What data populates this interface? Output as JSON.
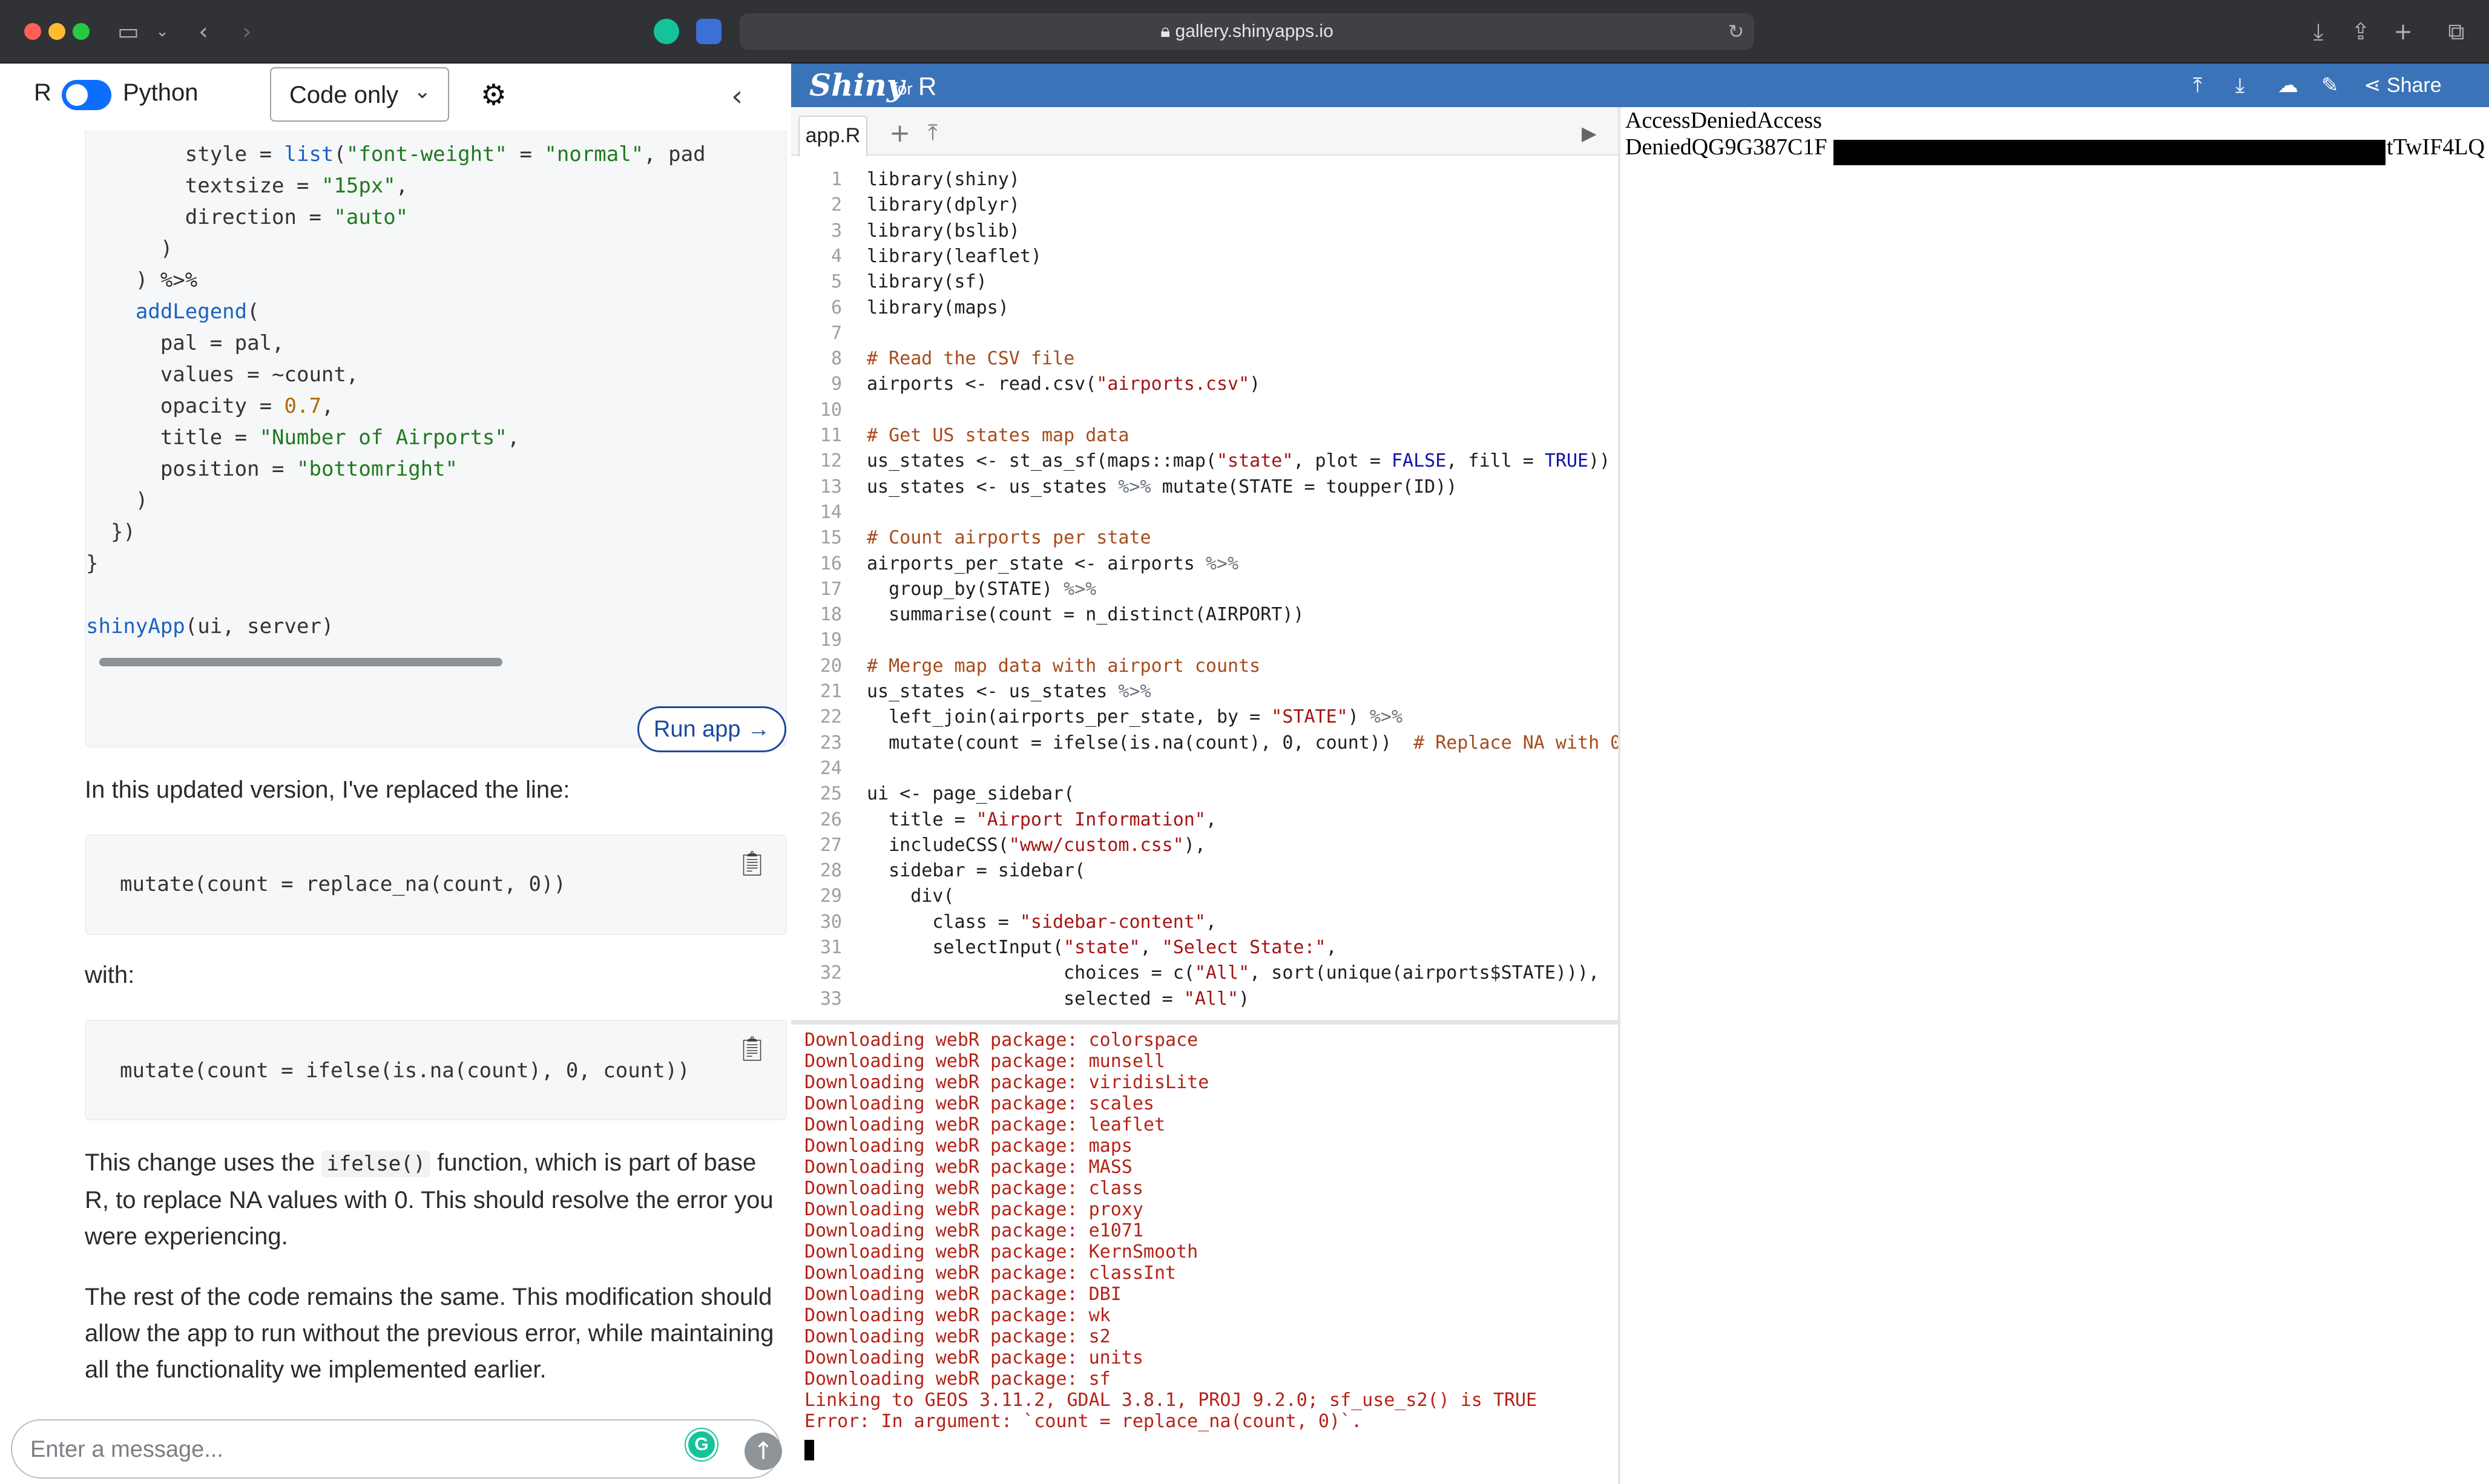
{
  "browser": {
    "url": "gallery.shinyapps.io",
    "colors": {
      "close": "#fe5f57",
      "minimize": "#febc2e",
      "maximize": "#28c840"
    },
    "icons": [
      "sidebar-icon",
      "chevron-down-icon",
      "back-icon",
      "forward-icon",
      "grammarly-icon",
      "shield-icon",
      "lock-icon",
      "reload-icon",
      "download-icon",
      "share-icon",
      "new-tab-icon",
      "tabs-overview-icon"
    ]
  },
  "chat": {
    "lang_left": "R",
    "lang_right": "Python",
    "mode": "Code only",
    "code_lines": [
      "        style = list(\"font-weight\" = \"normal\", pad",
      "        textsize = \"15px\",",
      "        direction = \"auto\"",
      "      )",
      "    ) %>%",
      "    addLegend(",
      "      pal = pal,",
      "      values = ~count,",
      "      opacity = 0.7,",
      "      title = \"Number of Airports\",",
      "      position = \"bottomright\"",
      "    )",
      "  })",
      "}",
      "",
      "shinyApp(ui, server)"
    ],
    "run_app_label": "Run app →",
    "p1": "In this updated version, I've replaced the line:",
    "snippet1": "mutate(count = replace_na(count, 0))",
    "p2": "with:",
    "snippet2": "mutate(count = ifelse(is.na(count), 0, count))",
    "p3_a": "This change uses the ",
    "p3_code": "ifelse()",
    "p3_b": " function, which is part of base R, to replace NA values with 0. This should resolve the error you were experiencing.",
    "p4": "The rest of the code remains the same. This modification should allow the app to run without the previous error, while maintaining all the functionality we implemented earlier.",
    "input_placeholder": "Enter a message..."
  },
  "shiny": {
    "logo": "Shiny",
    "for_text": "for",
    "lang": "R",
    "share_label": "Share",
    "accent": "#3b73b9",
    "tab_name": "app.R",
    "code": [
      "library(shiny)",
      "library(dplyr)",
      "library(bslib)",
      "library(leaflet)",
      "library(sf)",
      "library(maps)",
      "",
      "# Read the CSV file",
      "airports <- read.csv(\"airports.csv\")",
      "",
      "# Get US states map data",
      "us_states <- st_as_sf(maps::map(\"state\", plot = FALSE, fill = TRUE))",
      "us_states <- us_states %>% mutate(STATE = toupper(ID))",
      "",
      "# Count airports per state",
      "airports_per_state <- airports %>%",
      "  group_by(STATE) %>%",
      "  summarise(count = n_distinct(AIRPORT))",
      "",
      "# Merge map data with airport counts",
      "us_states <- us_states %>%",
      "  left_join(airports_per_state, by = \"STATE\") %>%",
      "  mutate(count = ifelse(is.na(count), 0, count))  # Replace NA with 0",
      "",
      "ui <- page_sidebar(",
      "  title = \"Airport Information\",",
      "  includeCSS(\"www/custom.css\"),",
      "  sidebar = sidebar(",
      "    div(",
      "      class = \"sidebar-content\",",
      "      selectInput(\"state\", \"Select State:\",",
      "                  choices = c(\"All\", sort(unique(airports$STATE))),",
      "                  selected = \"All\")"
    ],
    "console": [
      "Downloading webR package: colorspace",
      "Downloading webR package: munsell",
      "Downloading webR package: viridisLite",
      "Downloading webR package: scales",
      "Downloading webR package: leaflet",
      "Downloading webR package: maps",
      "Downloading webR package: MASS",
      "Downloading webR package: class",
      "Downloading webR package: proxy",
      "Downloading webR package: e1071",
      "Downloading webR package: KernSmooth",
      "Downloading webR package: classInt",
      "Downloading webR package: DBI",
      "Downloading webR package: wk",
      "Downloading webR package: s2",
      "Downloading webR package: units",
      "Downloading webR package: sf",
      "Linking to GEOS 3.11.2, GDAL 3.8.1, PROJ 9.2.0; sf_use_s2() is TRUE",
      "Error: In argument: `count = replace_na(count, 0)`."
    ],
    "console_color": "#b42318"
  },
  "output": {
    "line1": "AccessDeniedAccess",
    "line2_start": "DeniedQG9G387C1F",
    "line2_end": "tTwIF4LQ"
  }
}
